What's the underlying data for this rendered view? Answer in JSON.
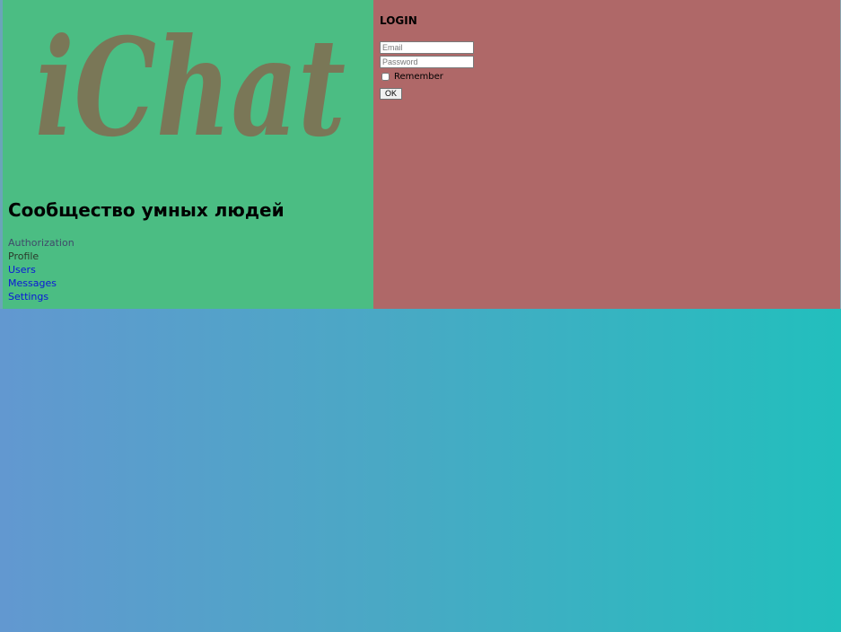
{
  "logo": {
    "text": "iChat",
    "color": "#7a7757"
  },
  "slogan": "Сообщество умных людей",
  "nav": {
    "items": [
      {
        "label": "Authorization"
      },
      {
        "label": "Profile"
      },
      {
        "label": "Users"
      },
      {
        "label": "Messages"
      },
      {
        "label": "Settings"
      }
    ]
  },
  "login": {
    "title": "LOGIN",
    "email_placeholder": "Email",
    "password_placeholder": "Password",
    "remember_label": "Remember",
    "ok_label": "OK"
  },
  "colors": {
    "left_panel": "#4bbd83",
    "right_panel": "#af6868",
    "link": "#0b16d8"
  }
}
